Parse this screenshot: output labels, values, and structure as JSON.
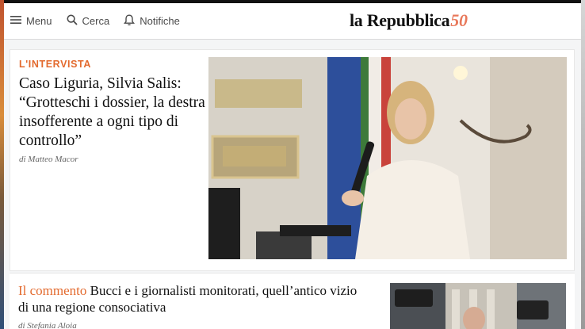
{
  "header": {
    "menu_label": "Menu",
    "search_label": "Cerca",
    "notifications_label": "Notifiche",
    "logo_text": "la Repubblica",
    "logo_anniversary": "50"
  },
  "main_story": {
    "kicker": "L'INTERVISTA",
    "headline": "Caso Liguria, Silvia Salis: “Grotteschi i dossier, la destra insofferente a ogni tipo di controllo”",
    "byline": "di Matteo Macor"
  },
  "second_story": {
    "kicker": "Il commento",
    "headline": "Bucci e i giornalisti monitorati, quell’antico vizio di una regione consociativa",
    "byline": "di Stefania Aloia"
  },
  "colors": {
    "accent": "#e36a2e",
    "logo_accent": "#e8785a",
    "text": "#111111"
  }
}
